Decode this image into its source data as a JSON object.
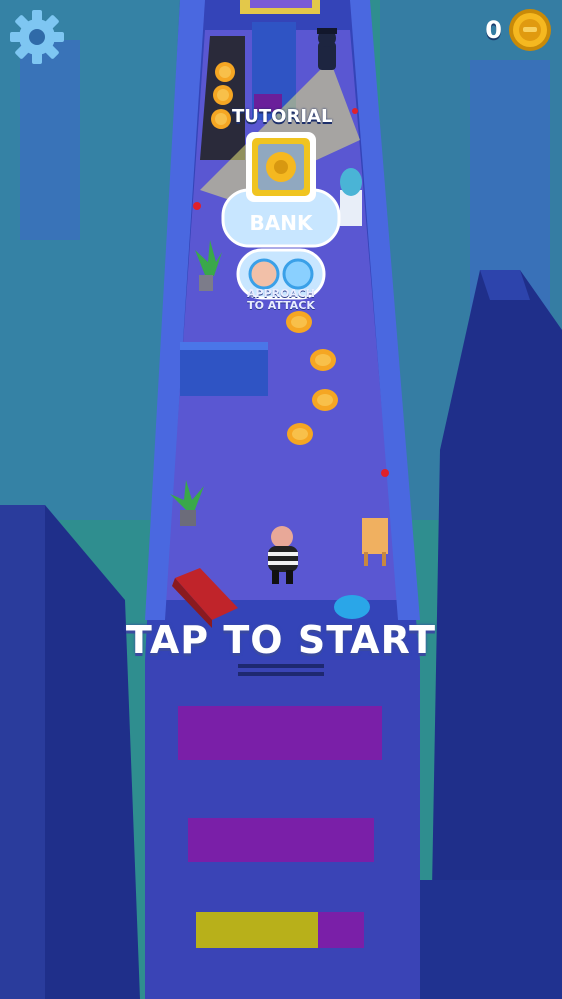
{
  "hud": {
    "coin_count": "0",
    "settings_icon": "gear-icon",
    "coin_icon": "coin-icon"
  },
  "level": {
    "tutorial_label": "TUTORIAL",
    "bank_label": "BANK",
    "attack_hint": "APPROACH\nTO ATTACK"
  },
  "start_prompt": "TAP TO START",
  "colors": {
    "background": "#2a8a8a",
    "building_dark": "#243a9a",
    "corridor_floor": "#5a5ad6",
    "coin": "#f5a623",
    "text_shadow": "#3a4aa0"
  }
}
